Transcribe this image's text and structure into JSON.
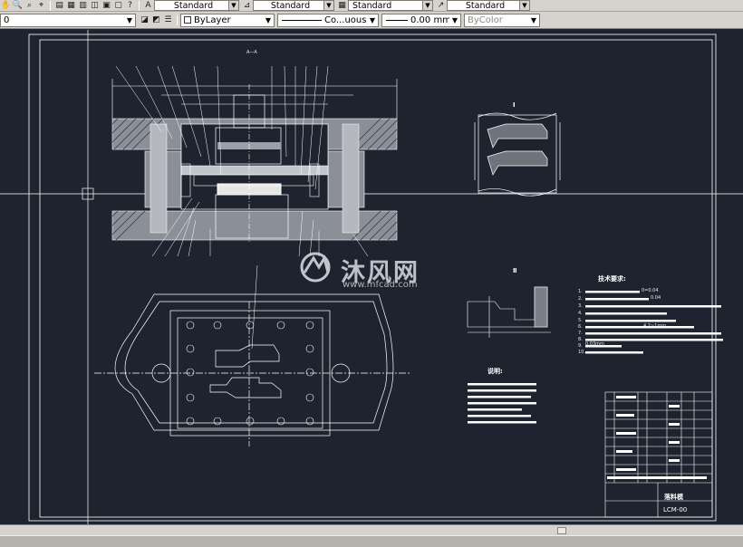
{
  "toolbar_styles": {
    "text_style": "Standard",
    "dim_style": "Standard",
    "table_style": "Standard",
    "mleader_style": "Standard"
  },
  "toolbar_properties": {
    "layer": "0",
    "color": "ByLayer",
    "linetype": "Co...uous",
    "lineweight": "0.00 mm",
    "plotstyle": "ByColor"
  },
  "drawing": {
    "section_label": "A—A",
    "view_title_right": "Ⅰ",
    "view_title_mid": "Ⅱ",
    "tech_title": "技术要求:",
    "notes_title": "说明:",
    "tech_items": [
      "1.",
      "2.",
      "3.",
      "4.",
      "5.",
      "6.",
      "7.",
      "8.",
      "9.",
      "10."
    ],
    "tech_fragments": [
      "0=0.04",
      "0.04",
      "4.2~1mm",
      "0.03mm"
    ],
    "part_name": "落料模",
    "drawing_code": "LCM-00"
  },
  "watermark": {
    "brand": "沐风网",
    "url": "www.mfcad.com"
  }
}
